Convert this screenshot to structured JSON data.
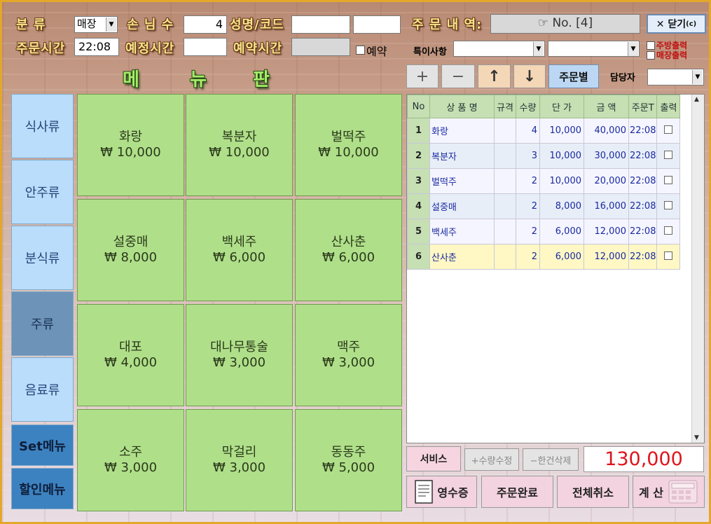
{
  "header": {
    "category_label": "분 류",
    "category_value": "매장",
    "guests_label": "손 님 수",
    "guests_value": "4",
    "name_label": "성명/코드",
    "order_history_label": "주 문 내 역:",
    "order_no": "☞ No. [4]",
    "close_label": "✕ 닫기",
    "close_shortcut": "(c)",
    "order_time_label": "주문시간",
    "order_time_value": "22:08",
    "scheduled_time_label": "예정시간",
    "reservation_time_label": "예약시간",
    "reservation_check_label": "예약",
    "special_label": "특이사항",
    "kitchen_print_label": "주방출력",
    "store_print_label": "매장출력"
  },
  "menu_panel": {
    "title_chars": [
      "메",
      "뉴",
      "판"
    ]
  },
  "toolbar": {
    "plus": "+",
    "minus": "−",
    "up": "↑",
    "down": "↓",
    "by_order": "주문별",
    "staff_label": "담당자"
  },
  "categories": [
    "식사류",
    "안주류",
    "분식류",
    "주류",
    "음료류",
    "Set메뉴",
    "할인메뉴"
  ],
  "menu_items": [
    {
      "name": "화랑",
      "price": "₩ 10,000"
    },
    {
      "name": "복분자",
      "price": "₩ 10,000"
    },
    {
      "name": "벌떡주",
      "price": "₩ 10,000"
    },
    {
      "name": "설중매",
      "price": "₩ 8,000"
    },
    {
      "name": "백세주",
      "price": "₩ 6,000"
    },
    {
      "name": "산사춘",
      "price": "₩ 6,000"
    },
    {
      "name": "대포",
      "price": "₩ 4,000"
    },
    {
      "name": "대나무통술",
      "price": "₩ 3,000"
    },
    {
      "name": "맥주",
      "price": "₩ 3,000"
    },
    {
      "name": "소주",
      "price": "₩ 3,000"
    },
    {
      "name": "막걸리",
      "price": "₩ 3,000"
    },
    {
      "name": "동동주",
      "price": "₩ 5,000"
    }
  ],
  "order_table": {
    "headers": [
      "No",
      "상 품 명",
      "규격",
      "수량",
      "단 가",
      "금 액",
      "주문T",
      "출력"
    ],
    "rows": [
      {
        "no": "1",
        "name": "화랑",
        "spec": "",
        "qty": "4",
        "price": "10,000",
        "amount": "40,000",
        "time": "22:08"
      },
      {
        "no": "2",
        "name": "복분자",
        "spec": "",
        "qty": "3",
        "price": "10,000",
        "amount": "30,000",
        "time": "22:08"
      },
      {
        "no": "3",
        "name": "벌떡주",
        "spec": "",
        "qty": "2",
        "price": "10,000",
        "amount": "20,000",
        "time": "22:08"
      },
      {
        "no": "4",
        "name": "설중매",
        "spec": "",
        "qty": "2",
        "price": "8,000",
        "amount": "16,000",
        "time": "22:08"
      },
      {
        "no": "5",
        "name": "백세주",
        "spec": "",
        "qty": "2",
        "price": "6,000",
        "amount": "12,000",
        "time": "22:08"
      },
      {
        "no": "6",
        "name": "산사춘",
        "spec": "",
        "qty": "2",
        "price": "6,000",
        "amount": "12,000",
        "time": "22:08"
      }
    ]
  },
  "bottom": {
    "service": "서비스",
    "qty_edit": "+수량수정",
    "delete_one": "−한건삭제",
    "total": "130,000",
    "receipt": "영수증",
    "order_done": "주문완료",
    "cancel_all": "전체취소",
    "checkout": "계 산"
  }
}
